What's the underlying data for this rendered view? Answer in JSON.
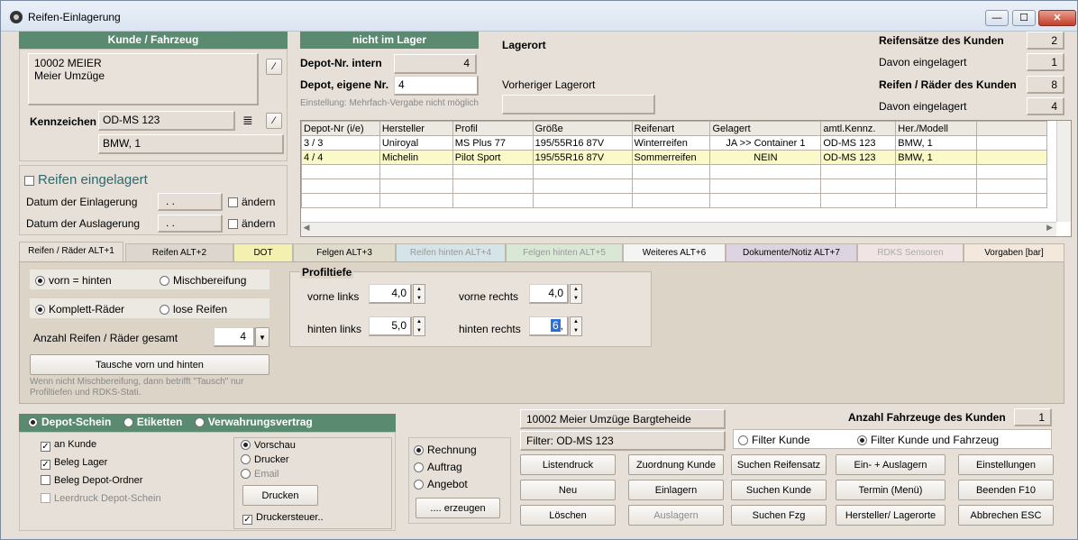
{
  "window": {
    "title": "Reifen-Einlagerung",
    "min": "—",
    "max": "☐",
    "close": "✕"
  },
  "kunde": {
    "header": "Kunde / Fahrzeug",
    "line1": "10002 MEIER",
    "line2": "Meier Umzüge",
    "kennzeichen_label": "Kennzeichen",
    "kennzeichen": "OD-MS 123",
    "fahrzeug": "BMW, 1"
  },
  "einlagerung": {
    "title": "Reifen eingelagert",
    "datum_ein_label": "Datum der Einlagerung",
    "datum_ein": ". .",
    "datum_aus_label": "Datum der Auslagerung",
    "datum_aus": ". .",
    "aendern": "ändern"
  },
  "depot": {
    "status": "nicht im Lager",
    "intern_label": "Depot-Nr. intern",
    "intern": "4",
    "eigene_label": "Depot, eigene Nr.",
    "eigene": "4",
    "hint": "Einstellung: Mehrfach-Vergabe nicht möglich",
    "lagerort_label": "Lagerort",
    "vorheriger_label": "Vorheriger Lagerort"
  },
  "stats": {
    "saetze_label": "Reifensätze des Kunden",
    "saetze": "2",
    "davon1_label": "Davon eingelagert",
    "davon1": "1",
    "raeder_label": "Reifen / Räder des Kunden",
    "raeder": "8",
    "davon2_label": "Davon eingelagert",
    "davon2": "4"
  },
  "table": {
    "headers": [
      "Depot-Nr (i/e)",
      "Hersteller",
      "Profil",
      "Größe",
      "Reifenart",
      "Gelagert",
      "amtl.Kennz.",
      "Her./Modell"
    ],
    "rows": [
      [
        "3 / 3",
        "Uniroyal",
        "MS Plus 77",
        "195/55R16 87V",
        "Winterreifen",
        "JA >> Container 1",
        "OD-MS 123",
        "BMW, 1"
      ],
      [
        "4 / 4",
        "Michelin",
        "Pilot Sport",
        "195/55R16 87V",
        "Sommerreifen",
        "NEIN",
        "OD-MS 123",
        "BMW, 1"
      ]
    ]
  },
  "tabs": [
    {
      "label": "Reifen / Räder ALT+1",
      "color": "#e6e0d8"
    },
    {
      "label": "Reifen ALT+2",
      "color": "#dcd6ce"
    },
    {
      "label": "DOT",
      "color": "#f4f0b0"
    },
    {
      "label": "Felgen ALT+3",
      "color": "#e0dccc"
    },
    {
      "label": "Reifen hinten ALT+4",
      "color": "#d4e4e8"
    },
    {
      "label": "Felgen hinten ALT+5",
      "color": "#d8e8d4"
    },
    {
      "label": "Weiteres ALT+6",
      "color": "#f4f4f4"
    },
    {
      "label": "Dokumente/Notiz ALT+7",
      "color": "#dcd4e0"
    },
    {
      "label": "RDKS Sensoren",
      "color": "#f0e4e4"
    },
    {
      "label": "Vorgaben [bar]",
      "color": "#f4e8dc"
    }
  ],
  "tab1": {
    "vorn_hinten": "vorn = hinten",
    "misch": "Mischbereifung",
    "komplett": "Komplett-Räder",
    "lose": "lose Reifen",
    "anzahl_label": "Anzahl Reifen / Räder gesamt",
    "anzahl": "4",
    "tausch_btn": "Tausche vorn und hinten",
    "hint": "Wenn nicht Mischbereifung, dann betrifft \"Tausch\" nur Profiltiefen und RDKS-Stati.",
    "profil_title": "Profiltiefe",
    "vl_label": "vorne links",
    "vl": "4,0",
    "vr_label": "vorne rechts",
    "vr": "4,0",
    "hl_label": "hinten links",
    "hl": "5,0",
    "hr_label": "hinten rechts",
    "hr": "6"
  },
  "print": {
    "opt1": "Depot-Schein",
    "opt2": "Etiketten",
    "opt3": "Verwahrungsvertrag",
    "c1": "an Kunde",
    "c2": "Beleg Lager",
    "c3": "Beleg Depot-Ordner",
    "c4": "Leerdruck Depot-Schein",
    "r1": "Vorschau",
    "r2": "Drucker",
    "r3": "Email",
    "drucken": "Drucken",
    "steuer": "Druckersteuer..",
    "rechnung": "Rechnung",
    "auftrag": "Auftrag",
    "angebot": "Angebot",
    "erzeugen": ".... erzeugen"
  },
  "bottom": {
    "kunde_info": "10002 Meier Umzüge Bargteheide",
    "filter": "Filter: OD-MS 123",
    "fz_label": "Anzahl Fahrzeuge des Kunden",
    "fz": "1",
    "filter_kunde": "Filter Kunde",
    "filter_kf": "Filter Kunde und Fahrzeug",
    "buttons": [
      "Listendruck",
      "Zuordnung Kunde",
      "Suchen Reifensatz",
      "Ein- + Auslagern",
      "Einstellungen",
      "Neu",
      "Einlagern",
      "Suchen Kunde",
      "Termin (Menü)",
      "Beenden F10",
      "Löschen",
      "Auslagern",
      "Suchen Fzg",
      "Hersteller/ Lagerorte",
      "Abbrechen ESC"
    ]
  }
}
